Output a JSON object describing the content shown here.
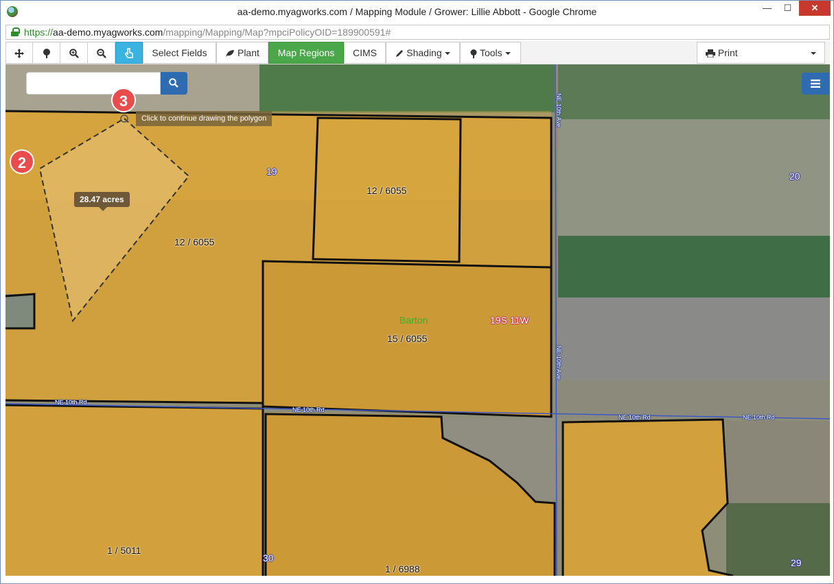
{
  "browser": {
    "title": "aa-demo.myagworks.com / Mapping Module / Grower: Lillie Abbott - Google Chrome",
    "url_scheme": "https://",
    "url_host": "aa-demo.myagworks.com",
    "url_path": "/mapping/Mapping/Map?mpciPolicyOID=189900591#",
    "minimize_glyph": "—",
    "maximize_glyph": "☐",
    "close_glyph": "✕"
  },
  "toolbar": {
    "select_fields": "Select Fields",
    "plant": "Plant",
    "map_regions": "Map Regions",
    "cims": "CIMS",
    "shading": "Shading",
    "tools": "Tools",
    "print": "Print"
  },
  "map": {
    "search_placeholder": "",
    "tooltip": "Click to continue drawing the polygon",
    "acres": "28.47 acres",
    "field_labels": [
      "12 / 6055",
      "12 / 6055",
      "15 / 6055",
      "1 / 5011",
      "1 / 6988"
    ],
    "section_labels": [
      "19",
      "20",
      "30",
      "29"
    ],
    "county_label": "Barton",
    "township_label": "19S 11W",
    "road_labels": [
      "NE 10th Ave",
      "NE 10th Ave",
      "NE 10th Rd",
      "NE 10th Rd",
      "NE 10th Rd",
      "NE 10th Rd"
    ],
    "badges": [
      "2",
      "3"
    ]
  },
  "colors": {
    "field_fill": "#d6a23a",
    "accent_blue": "#3bb3e1",
    "accent_green": "#4aa84a",
    "badge_red": "#e84c4c"
  }
}
